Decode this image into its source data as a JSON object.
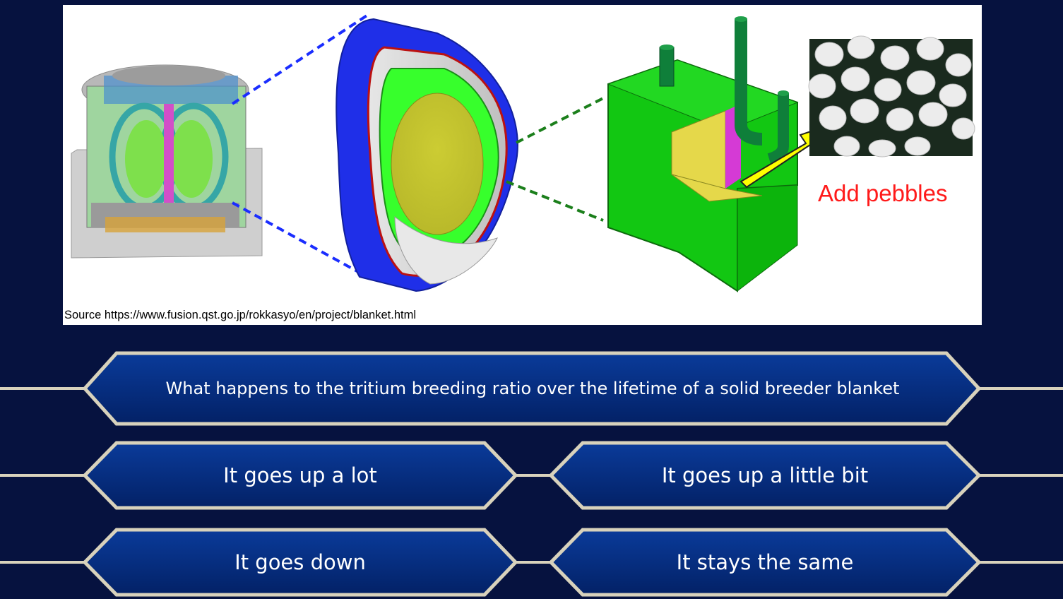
{
  "figure": {
    "source_note": "Source https://www.fusion.qst.go.jp/rokkasyo/en/project/blanket.html",
    "callout": "Add pebbles"
  },
  "question": {
    "text": "What happens to the tritium breeding ratio over the lifetime of a solid breeder blanket"
  },
  "answers": [
    {
      "text": "It goes up a lot"
    },
    {
      "text": "It goes up a little bit"
    },
    {
      "text": "It goes down"
    },
    {
      "text": "It stays the same"
    }
  ],
  "colors": {
    "background": "#06123f",
    "panel_fill_top": "#0a3b9a",
    "panel_fill_bottom": "#032166",
    "panel_border": "#d8d2bc",
    "callout_text": "#ff1a1a"
  }
}
